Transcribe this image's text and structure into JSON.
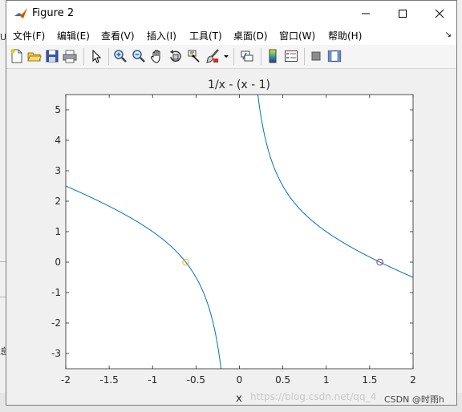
{
  "window": {
    "title": "Figure 2"
  },
  "menu": {
    "items": [
      "文件(F)",
      "编辑(E)",
      "查看(V)",
      "插入(I)",
      "工具(T)",
      "桌面(D)",
      "窗口(W)",
      "帮助(H)"
    ],
    "overflow_arrow": "↘"
  },
  "toolbar": {
    "buttons": [
      {
        "name": "new-figure-icon"
      },
      {
        "name": "open-file-icon"
      },
      {
        "name": "save-icon"
      },
      {
        "name": "print-icon"
      },
      {
        "name": "edit-plot-arrow-icon"
      },
      {
        "name": "zoom-in-icon"
      },
      {
        "name": "zoom-out-icon"
      },
      {
        "name": "pan-hand-icon"
      },
      {
        "name": "rotate-3d-icon"
      },
      {
        "name": "data-cursor-icon"
      },
      {
        "name": "brush-icon"
      },
      {
        "name": "brush-dropdown-icon"
      },
      {
        "name": "link-plot-icon"
      },
      {
        "name": "colorbar-icon"
      },
      {
        "name": "legend-icon"
      },
      {
        "name": "hide-plot-tools-icon"
      },
      {
        "name": "show-plot-tools-icon"
      }
    ]
  },
  "background": {
    "left_chars": [
      "U",
      "息"
    ]
  },
  "footer": {
    "watermark": "https://blog.csdn.net/qq_4",
    "csdn_tag": "CSDN @时雨h"
  },
  "colors": {
    "curve": "#0072bd",
    "root_marker_left": "#edb120",
    "root_marker_right": "#7e2f8e",
    "figure_bg": "#f0f0f0",
    "axes_bg": "#ffffff"
  },
  "chart_data": {
    "type": "line",
    "title": "1/x - (x - 1)",
    "xlabel": "x",
    "ylabel": "",
    "xlim": [
      -2,
      2
    ],
    "ylim": [
      -3.5,
      5.5
    ],
    "xticks": [
      "-2",
      "-1.5",
      "-1",
      "-0.5",
      "0",
      "0.5",
      "1",
      "1.5",
      "2"
    ],
    "yticks": [
      "-3",
      "-2",
      "-1",
      "0",
      "1",
      "2",
      "3",
      "4",
      "5"
    ],
    "function": "1/x - (x - 1)",
    "grid": false,
    "roots": [
      {
        "x": -0.618,
        "y": 0
      },
      {
        "x": 1.618,
        "y": 0
      }
    ]
  }
}
